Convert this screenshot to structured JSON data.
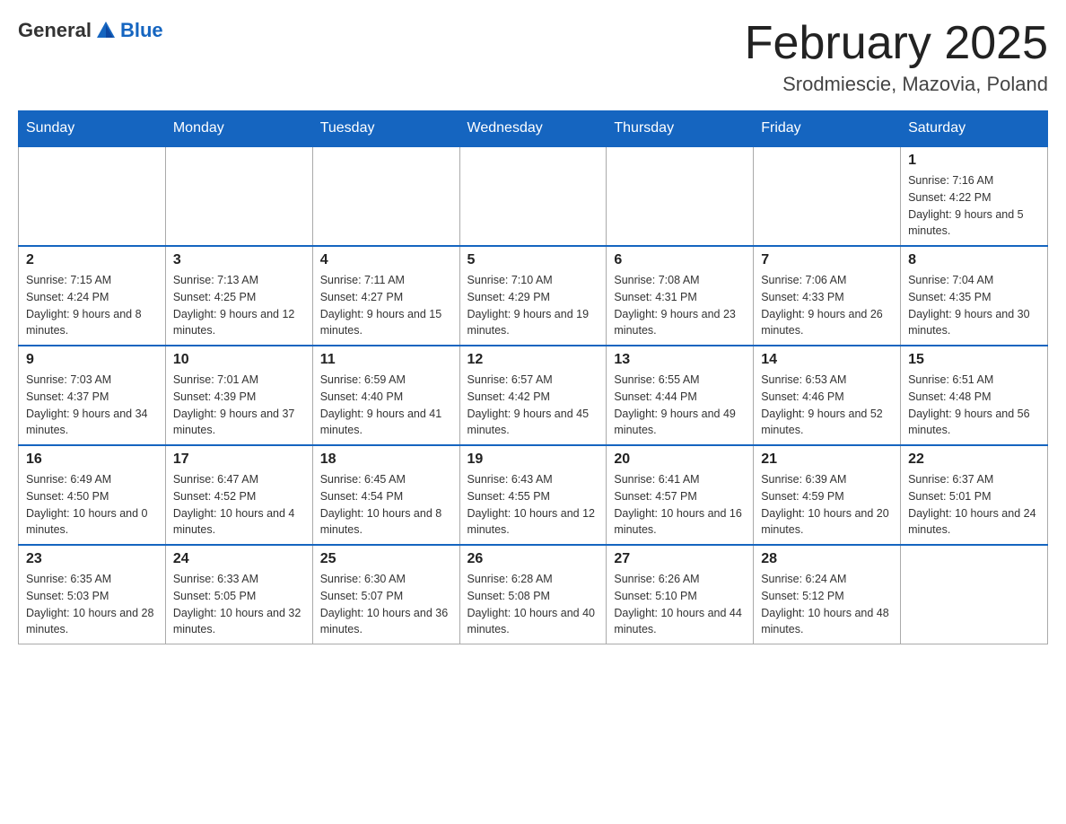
{
  "logo": {
    "text_general": "General",
    "text_blue": "Blue"
  },
  "title": "February 2025",
  "location": "Srodmiescie, Mazovia, Poland",
  "days_of_week": [
    "Sunday",
    "Monday",
    "Tuesday",
    "Wednesday",
    "Thursday",
    "Friday",
    "Saturday"
  ],
  "weeks": [
    [
      {
        "day": "",
        "info": ""
      },
      {
        "day": "",
        "info": ""
      },
      {
        "day": "",
        "info": ""
      },
      {
        "day": "",
        "info": ""
      },
      {
        "day": "",
        "info": ""
      },
      {
        "day": "",
        "info": ""
      },
      {
        "day": "1",
        "info": "Sunrise: 7:16 AM\nSunset: 4:22 PM\nDaylight: 9 hours and 5 minutes."
      }
    ],
    [
      {
        "day": "2",
        "info": "Sunrise: 7:15 AM\nSunset: 4:24 PM\nDaylight: 9 hours and 8 minutes."
      },
      {
        "day": "3",
        "info": "Sunrise: 7:13 AM\nSunset: 4:25 PM\nDaylight: 9 hours and 12 minutes."
      },
      {
        "day": "4",
        "info": "Sunrise: 7:11 AM\nSunset: 4:27 PM\nDaylight: 9 hours and 15 minutes."
      },
      {
        "day": "5",
        "info": "Sunrise: 7:10 AM\nSunset: 4:29 PM\nDaylight: 9 hours and 19 minutes."
      },
      {
        "day": "6",
        "info": "Sunrise: 7:08 AM\nSunset: 4:31 PM\nDaylight: 9 hours and 23 minutes."
      },
      {
        "day": "7",
        "info": "Sunrise: 7:06 AM\nSunset: 4:33 PM\nDaylight: 9 hours and 26 minutes."
      },
      {
        "day": "8",
        "info": "Sunrise: 7:04 AM\nSunset: 4:35 PM\nDaylight: 9 hours and 30 minutes."
      }
    ],
    [
      {
        "day": "9",
        "info": "Sunrise: 7:03 AM\nSunset: 4:37 PM\nDaylight: 9 hours and 34 minutes."
      },
      {
        "day": "10",
        "info": "Sunrise: 7:01 AM\nSunset: 4:39 PM\nDaylight: 9 hours and 37 minutes."
      },
      {
        "day": "11",
        "info": "Sunrise: 6:59 AM\nSunset: 4:40 PM\nDaylight: 9 hours and 41 minutes."
      },
      {
        "day": "12",
        "info": "Sunrise: 6:57 AM\nSunset: 4:42 PM\nDaylight: 9 hours and 45 minutes."
      },
      {
        "day": "13",
        "info": "Sunrise: 6:55 AM\nSunset: 4:44 PM\nDaylight: 9 hours and 49 minutes."
      },
      {
        "day": "14",
        "info": "Sunrise: 6:53 AM\nSunset: 4:46 PM\nDaylight: 9 hours and 52 minutes."
      },
      {
        "day": "15",
        "info": "Sunrise: 6:51 AM\nSunset: 4:48 PM\nDaylight: 9 hours and 56 minutes."
      }
    ],
    [
      {
        "day": "16",
        "info": "Sunrise: 6:49 AM\nSunset: 4:50 PM\nDaylight: 10 hours and 0 minutes."
      },
      {
        "day": "17",
        "info": "Sunrise: 6:47 AM\nSunset: 4:52 PM\nDaylight: 10 hours and 4 minutes."
      },
      {
        "day": "18",
        "info": "Sunrise: 6:45 AM\nSunset: 4:54 PM\nDaylight: 10 hours and 8 minutes."
      },
      {
        "day": "19",
        "info": "Sunrise: 6:43 AM\nSunset: 4:55 PM\nDaylight: 10 hours and 12 minutes."
      },
      {
        "day": "20",
        "info": "Sunrise: 6:41 AM\nSunset: 4:57 PM\nDaylight: 10 hours and 16 minutes."
      },
      {
        "day": "21",
        "info": "Sunrise: 6:39 AM\nSunset: 4:59 PM\nDaylight: 10 hours and 20 minutes."
      },
      {
        "day": "22",
        "info": "Sunrise: 6:37 AM\nSunset: 5:01 PM\nDaylight: 10 hours and 24 minutes."
      }
    ],
    [
      {
        "day": "23",
        "info": "Sunrise: 6:35 AM\nSunset: 5:03 PM\nDaylight: 10 hours and 28 minutes."
      },
      {
        "day": "24",
        "info": "Sunrise: 6:33 AM\nSunset: 5:05 PM\nDaylight: 10 hours and 32 minutes."
      },
      {
        "day": "25",
        "info": "Sunrise: 6:30 AM\nSunset: 5:07 PM\nDaylight: 10 hours and 36 minutes."
      },
      {
        "day": "26",
        "info": "Sunrise: 6:28 AM\nSunset: 5:08 PM\nDaylight: 10 hours and 40 minutes."
      },
      {
        "day": "27",
        "info": "Sunrise: 6:26 AM\nSunset: 5:10 PM\nDaylight: 10 hours and 44 minutes."
      },
      {
        "day": "28",
        "info": "Sunrise: 6:24 AM\nSunset: 5:12 PM\nDaylight: 10 hours and 48 minutes."
      },
      {
        "day": "",
        "info": ""
      }
    ]
  ]
}
